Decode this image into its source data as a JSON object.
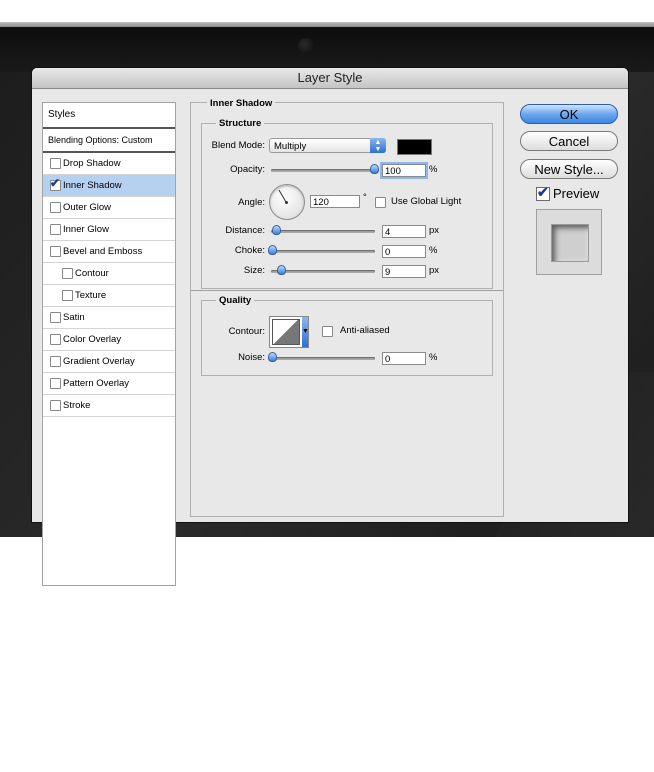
{
  "dialog": {
    "title": "Layer Style"
  },
  "left_panel": {
    "header": "Styles",
    "blending_options": "Blending Options: Custom",
    "items": [
      {
        "label": "Drop Shadow",
        "checked": false,
        "active": false,
        "sub": false
      },
      {
        "label": "Inner Shadow",
        "checked": true,
        "active": true,
        "sub": false
      },
      {
        "label": "Outer Glow",
        "checked": false,
        "active": false,
        "sub": false
      },
      {
        "label": "Inner Glow",
        "checked": false,
        "active": false,
        "sub": false
      },
      {
        "label": "Bevel and Emboss",
        "checked": false,
        "active": false,
        "sub": false
      },
      {
        "label": "Contour",
        "checked": false,
        "active": false,
        "sub": true
      },
      {
        "label": "Texture",
        "checked": false,
        "active": false,
        "sub": true
      },
      {
        "label": "Satin",
        "checked": false,
        "active": false,
        "sub": false
      },
      {
        "label": "Color Overlay",
        "checked": false,
        "active": false,
        "sub": false
      },
      {
        "label": "Gradient Overlay",
        "checked": false,
        "active": false,
        "sub": false
      },
      {
        "label": "Pattern Overlay",
        "checked": false,
        "active": false,
        "sub": false
      },
      {
        "label": "Stroke",
        "checked": false,
        "active": false,
        "sub": false
      }
    ]
  },
  "inner_shadow": {
    "title": "Inner Shadow",
    "structure": {
      "title": "Structure",
      "blend_mode_label": "Blend Mode:",
      "blend_mode_value": "Multiply",
      "color": "#000000",
      "opacity_label": "Opacity:",
      "opacity_value": "100",
      "opacity_unit": "%",
      "opacity_fraction": 1.0,
      "angle_label": "Angle:",
      "angle_value": "120",
      "angle_unit": "°",
      "use_global_light_label": "Use Global Light",
      "use_global_light_checked": false,
      "distance_label": "Distance:",
      "distance_value": "4",
      "distance_unit": "px",
      "choke_label": "Choke:",
      "choke_value": "0",
      "choke_unit": "%",
      "size_label": "Size:",
      "size_value": "9",
      "size_unit": "px"
    },
    "quality": {
      "title": "Quality",
      "contour_label": "Contour:",
      "anti_aliased_label": "Anti-aliased",
      "anti_aliased_checked": false,
      "noise_label": "Noise:",
      "noise_value": "0",
      "noise_unit": "%"
    }
  },
  "buttons": {
    "ok": "OK",
    "cancel": "Cancel",
    "new_style": "New Style...",
    "preview_label": "Preview",
    "preview_checked": true
  }
}
